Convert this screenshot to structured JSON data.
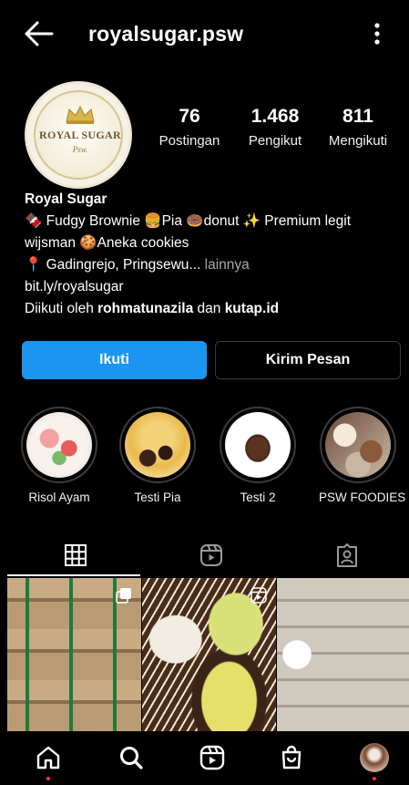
{
  "header": {
    "username": "royalsugar.psw",
    "back_icon": "back-arrow-icon",
    "menu_icon": "more-vertical-icon"
  },
  "profile": {
    "avatar_brand": "ROYAL SUGAR",
    "avatar_sub": "Psw.",
    "stats": [
      {
        "value": "76",
        "label": "Postingan"
      },
      {
        "value": "1.468",
        "label": "Pengikut"
      },
      {
        "value": "811",
        "label": "Mengikuti"
      }
    ]
  },
  "bio": {
    "name": "Royal Sugar",
    "line1": "🍫 Fudgy Brownie 🍔Pia 🍩donut ✨ Premium legit",
    "line2": "wijsman 🍪Aneka cookies",
    "line3_text": "📍 Gadingrejo, Pringsewu...",
    "line3_more": " lainnya",
    "link": "bit.ly/royalsugar",
    "followed_prefix": "Diikuti oleh ",
    "followed_user1": "rohmatunazila",
    "followed_mid": " dan ",
    "followed_user2": "kutap.id"
  },
  "actions": {
    "follow_label": "Ikuti",
    "message_label": "Kirim Pesan"
  },
  "highlights": [
    {
      "label": "Risol Ayam"
    },
    {
      "label": "Testi Pia"
    },
    {
      "label": "Testi 2"
    },
    {
      "label": "PSW FOODIES"
    }
  ],
  "tabs": [
    {
      "icon": "grid-icon"
    },
    {
      "icon": "reels-icon"
    },
    {
      "icon": "tagged-icon"
    }
  ],
  "nav": [
    {
      "icon": "home-icon"
    },
    {
      "icon": "search-icon"
    },
    {
      "icon": "reels-icon"
    },
    {
      "icon": "shop-icon"
    },
    {
      "icon": "profile-avatar"
    }
  ],
  "colors": {
    "background": "#000000",
    "follow_button": "#1a96f0",
    "notification_dot": "#ff2f4f"
  }
}
